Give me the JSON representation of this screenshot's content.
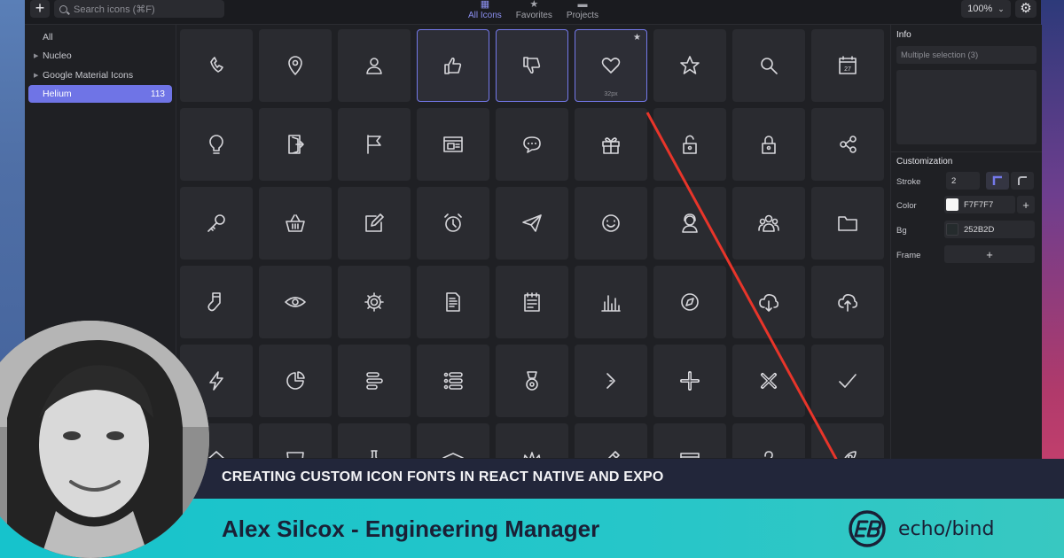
{
  "toolbar": {
    "add_label": "+",
    "search_placeholder": "Search icons (⌘F)",
    "zoom_value": "100%"
  },
  "tabs": [
    {
      "label": "All Icons",
      "icon": "grid-icon",
      "active": true
    },
    {
      "label": "Favorites",
      "icon": "star-icon",
      "active": false
    },
    {
      "label": "Projects",
      "icon": "folder-icon",
      "active": false
    }
  ],
  "sidebar": {
    "items": [
      {
        "label": "All",
        "expandable": false,
        "count": "",
        "active": false
      },
      {
        "label": "Nucleo",
        "expandable": true,
        "count": "",
        "active": false
      },
      {
        "label": "Google Material Icons",
        "expandable": true,
        "count": "",
        "active": false
      },
      {
        "label": "Helium",
        "expandable": false,
        "count": "113",
        "active": true
      }
    ]
  },
  "icon_grid": {
    "selected_size_label": "32px",
    "icons": [
      [
        "phone-icon",
        "location-pin-icon",
        "user-badge-icon",
        "thumbs-up-icon",
        "thumbs-down-icon",
        "heart-icon",
        "star-icon",
        "search-icon",
        "calendar-icon"
      ],
      [
        "lightbulb-icon",
        "door-exit-icon",
        "flag-icon",
        "browser-window-icon",
        "chat-bubble-icon",
        "gift-icon",
        "unlock-icon",
        "lock-icon",
        "share-icon"
      ],
      [
        "key-icon",
        "basket-icon",
        "edit-note-icon",
        "alarm-clock-icon",
        "paper-plane-icon",
        "smiley-icon",
        "user-support-icon",
        "users-group-icon",
        "folder-icon"
      ],
      [
        "sock-icon",
        "eye-icon",
        "gear-icon",
        "document-icon",
        "notepad-icon",
        "bar-chart-icon",
        "compass-icon",
        "cloud-download-icon",
        "cloud-upload-icon"
      ],
      [
        "lightning-icon",
        "pie-chart-icon",
        "align-left-icon",
        "list-icon",
        "medal-icon",
        "chevron-right-icon",
        "plus-icon",
        "close-icon",
        "check-icon"
      ],
      [
        "home-icon",
        "shorts-icon",
        "flask-icon",
        "graduation-cap-icon",
        "crown-icon",
        "pencil-icon",
        "calendar-strip-icon",
        "question-icon",
        "rocket-icon"
      ]
    ],
    "calendar_day": "27"
  },
  "panel": {
    "info_title": "Info",
    "info_selection": "Multiple selection (3)",
    "customization_title": "Customization",
    "stroke_label": "Stroke",
    "stroke_value": "2",
    "color_label": "Color",
    "color_value": "F7F7F7",
    "bg_label": "Bg",
    "bg_value": "252B2D",
    "frame_label": "Frame",
    "plus": "+"
  },
  "banner": {
    "headline": "CREATING CUSTOM ICON FONTS IN REACT NATIVE AND EXPO",
    "presenter": "Alex Silcox - Engineering Manager",
    "logo_text": "echo/bind"
  },
  "colors": {
    "accent": "#7479EA",
    "annotation_line": "#E8352A",
    "teal": "#1CC4CB",
    "navy": "#1A2036"
  }
}
